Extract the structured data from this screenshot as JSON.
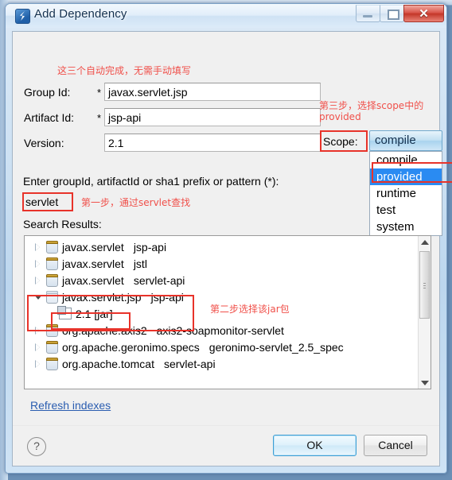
{
  "window": {
    "title": "Add Dependency",
    "icon": "maven-dependency-icon",
    "buttons": {
      "minimize": "minimize-button",
      "maximize": "maximize-button",
      "close": "✕"
    }
  },
  "form": {
    "group_id": {
      "label": "Group Id:",
      "required_mark": "*",
      "value": "javax.servlet.jsp"
    },
    "artifact_id": {
      "label": "Artifact Id:",
      "required_mark": "*",
      "value": "jsp-api"
    },
    "version": {
      "label": "Version:",
      "value": "2.1"
    },
    "scope": {
      "label": "Scope:",
      "selected": "compile",
      "options": [
        "compile",
        "provided",
        "runtime",
        "test",
        "system"
      ],
      "highlighted_option": "provided"
    }
  },
  "search": {
    "prompt": "Enter groupId, artifactId or sha1 prefix or pattern (*):",
    "input_value": "servlet",
    "results_label": "Search Results:"
  },
  "results": [
    {
      "group": "javax.servlet",
      "artifact": "jsp-api",
      "expanded": false,
      "icon": "jar-icon"
    },
    {
      "group": "javax.servlet",
      "artifact": "jstl",
      "expanded": false,
      "icon": "jar-icon"
    },
    {
      "group": "javax.servlet",
      "artifact": "servlet-api",
      "expanded": false,
      "icon": "jar-icon"
    },
    {
      "group": "javax.servlet.jsp",
      "artifact": "jsp-api",
      "expanded": true,
      "icon": "jar-icon"
    },
    {
      "version_child": "2.1 [jar]",
      "icon": "version-icon"
    },
    {
      "group": "org.apache.axis2",
      "artifact": "axis2-soapmonitor-servlet",
      "expanded": false,
      "icon": "jar-icon"
    },
    {
      "group": "org.apache.geronimo.specs",
      "artifact": "geronimo-servlet_2.5_spec",
      "expanded": false,
      "icon": "jar-icon"
    },
    {
      "group": "org.apache.tomcat",
      "artifact": "servlet-api",
      "expanded": false,
      "icon": "jar-icon"
    }
  ],
  "links": {
    "refresh_indexes": "Refresh indexes"
  },
  "footer": {
    "help": "?",
    "ok": "OK",
    "cancel": "Cancel"
  },
  "annotations": {
    "top": "这三个自动完成，无需手动填写",
    "scope_note": "第三步，选择scope中的\nprovided",
    "step_one": "第一步，通过servlet查找",
    "step_two": "第二步选择该jar包"
  },
  "colors": {
    "annotation_red": "#f0504a",
    "highlight_box": "#e8332a",
    "selection_blue": "#2a8bf2",
    "link_blue": "#2a5db0"
  }
}
